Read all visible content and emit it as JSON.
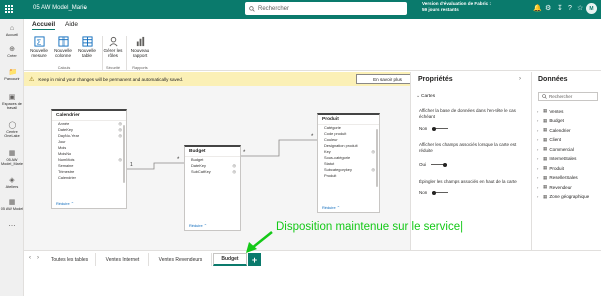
{
  "titlebar": {
    "title": "05 AW Model_Marie",
    "title_chevron": "⌄",
    "search_placeholder": "Rechercher",
    "trial_line1": "Version d'évaluation de Fabric :",
    "trial_line2": "59 jours restants",
    "icons": [
      "bell-icon",
      "gear-icon",
      "download-icon",
      "help-icon",
      "share-icon"
    ],
    "brand_color": "#0a7a6c"
  },
  "leftnav": {
    "items": [
      {
        "label": "Accueil",
        "icon": "home-icon"
      },
      {
        "label": "Créer",
        "icon": "create-icon"
      },
      {
        "label": "Parcourir",
        "icon": "browse-icon"
      },
      {
        "label": "Espaces de travail",
        "icon": "workspaces-icon"
      },
      {
        "label": "Centre OneLake",
        "icon": "onelake-icon"
      },
      {
        "label": "05 AW Model_Marie",
        "icon": "model-icon"
      },
      {
        "label": "Ateliers",
        "icon": "workshops-icon"
      },
      {
        "label": "05 AW Model",
        "icon": "model2-icon"
      }
    ]
  },
  "ribbon": {
    "tabs": [
      "Accueil",
      "Aide"
    ],
    "buttons": [
      {
        "label": "Nouvelle mesure",
        "icon": "measure-icon"
      },
      {
        "label": "Nouvelle colonne",
        "icon": "column-icon"
      },
      {
        "label": "Nouvelle table",
        "icon": "table-icon"
      },
      {
        "label": "Gérer les rôles",
        "icon": "roles-icon"
      },
      {
        "label": "Nouveau rapport",
        "icon": "report-icon"
      }
    ],
    "groups": [
      "Calculs",
      "Sécurité",
      "Rapports"
    ]
  },
  "banner": {
    "message": "Keep in mind your changes will be permanent and automatically saved.",
    "button": "En savoir plus",
    "icon": "warning-icon"
  },
  "canvas": {
    "tables": [
      {
        "name": "Calendrier",
        "fields": [
          "Année",
          "DateKey",
          "DayNo-Year",
          "Jour",
          "Mois",
          "MoisNo",
          "NumMois",
          "Semaine",
          "Trimestre",
          "Calendrier"
        ],
        "eyes": [
          1,
          1,
          1,
          0,
          0,
          0,
          1,
          0,
          0,
          0
        ],
        "footer": "Réduire ⌃"
      },
      {
        "name": "Budget",
        "fields": [
          "Budget",
          "DateKey",
          "SubCatKey"
        ],
        "eyes": [
          0,
          1,
          1
        ],
        "footer": "Réduire ⌃"
      },
      {
        "name": "Produit",
        "fields": [
          "Catégorie",
          "Code produit",
          "Couleur",
          "Designation produit",
          "Key",
          "Sous-catégorie",
          "Statut",
          "Subcategorykey",
          "Produit"
        ],
        "eyes": [
          0,
          0,
          0,
          0,
          1,
          0,
          0,
          1,
          0
        ],
        "footer": "Réduire ⌃"
      }
    ],
    "relationships": [
      {
        "from": "Calendrier",
        "to": "Budget",
        "from_card": "1",
        "to_card": "*"
      },
      {
        "from": "Budget",
        "to": "Produit",
        "from_card": "*",
        "to_card": "*"
      }
    ]
  },
  "properties": {
    "title": "Propriétés",
    "section": "Cartes",
    "settings": [
      {
        "text": "Afficher la base de données dans l'en-tête le cas échéant",
        "value": "Non",
        "on": false
      },
      {
        "text": "Afficher les champs associés lorsque la carte est réduite",
        "value": "Oui",
        "on": true
      },
      {
        "text": "Épingler les champs associés en haut de la carte",
        "value": "Non",
        "on": false
      }
    ]
  },
  "data_pane": {
    "title": "Données",
    "search_placeholder": "Rechercher",
    "tables": [
      "Ventes",
      "Budget",
      "Calendrier",
      "Client",
      "Commercial",
      "InternetSales",
      "Produit",
      "ResellerSales",
      "Revendeur",
      "Zone géographique"
    ]
  },
  "pages": {
    "tabs": [
      "Toutes les tables",
      "Ventes Internet",
      "Ventes Revendeurs",
      "Budget"
    ],
    "active_index": 3,
    "add_label": "+"
  },
  "annotation": {
    "text": "Disposition maintenue sur le service|",
    "color": "#15c918"
  }
}
